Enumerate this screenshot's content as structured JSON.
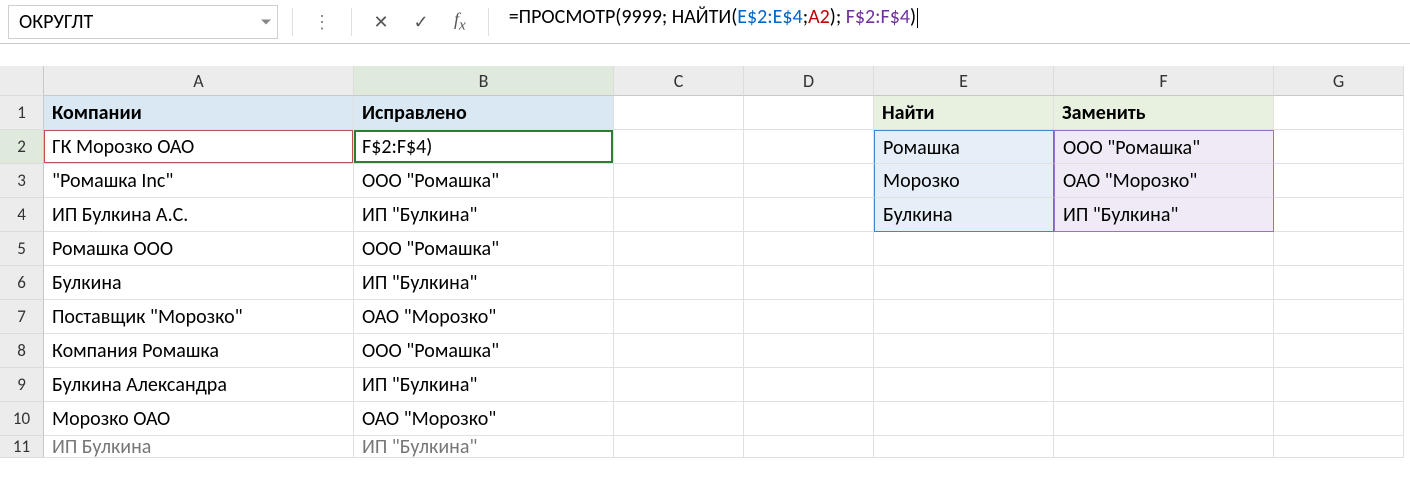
{
  "nameBox": "ОКРУГЛТ",
  "formula": {
    "seg1": "=ПРОСМОТР(9999; НАЙТИ(",
    "seg2": "E$2:E$4",
    "seg3": ";",
    "seg4": "A2",
    "seg5": "); ",
    "seg6": "F$2:F$4",
    "seg7": ")"
  },
  "columns": [
    "A",
    "B",
    "C",
    "D",
    "E",
    "F",
    "G"
  ],
  "rows": [
    "1",
    "2",
    "3",
    "4",
    "5",
    "6",
    "7",
    "8",
    "9",
    "10",
    "11"
  ],
  "headers": {
    "A1": "Компании",
    "B1": "Исправлено",
    "E1": "Найти",
    "F1": "Заменить"
  },
  "colA": {
    "2": "ГК Морозко ОАО",
    "3": "\"Ромашка Inc\"",
    "4": "ИП Булкина А.С.",
    "5": "Ромашка ООО",
    "6": "Булкина",
    "7": "Поставщик \"Морозко\"",
    "8": "Компания Ромашка",
    "9": "Булкина Александра",
    "10": "Морозко ОАО",
    "11": "ИП Булкина"
  },
  "colB": {
    "2": "F$2:F$4)",
    "3": "ООО \"Ромашка\"",
    "4": "ИП \"Булкина\"",
    "5": "ООО \"Ромашка\"",
    "6": "ИП \"Булкина\"",
    "7": "ОАО \"Морозко\"",
    "8": "ООО \"Ромашка\"",
    "9": "ИП \"Булкина\"",
    "10": "ОАО \"Морозко\"",
    "11": "ИП \"Булкина\""
  },
  "colE": {
    "2": "Ромашка",
    "3": "Морозко",
    "4": "Булкина"
  },
  "colF": {
    "2": "ООО \"Ромашка\"",
    "3": "ОАО \"Морозко\"",
    "4": "ИП \"Булкина\""
  }
}
